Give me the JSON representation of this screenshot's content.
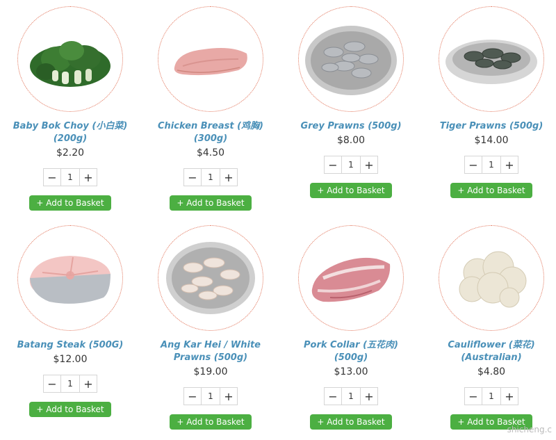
{
  "products": [
    {
      "name": "Baby Bok Choy (小白菜) (200g)",
      "price": "$2.20",
      "qty": "1",
      "add_label": "+ Add to Basket",
      "image": "bok-choy"
    },
    {
      "name": "Chicken Breast (鸡胸) (300g)",
      "price": "$4.50",
      "qty": "1",
      "add_label": "+ Add to Basket",
      "image": "chicken-breast"
    },
    {
      "name": "Grey Prawns (500g)",
      "price": "$8.00",
      "qty": "1",
      "add_label": "+ Add to Basket",
      "image": "grey-prawns"
    },
    {
      "name": "Tiger Prawns (500g)",
      "price": "$14.00",
      "qty": "1",
      "add_label": "+ Add to Basket",
      "image": "tiger-prawns"
    },
    {
      "name": "Batang Steak (500G)",
      "price": "$12.00",
      "qty": "1",
      "add_label": "+ Add to Basket",
      "image": "batang-steak"
    },
    {
      "name": "Ang Kar Hei / White Prawns (500g)",
      "price": "$19.00",
      "qty": "1",
      "add_label": "+ Add to Basket",
      "image": "white-prawns"
    },
    {
      "name": "Pork Collar (五花肉) (500g)",
      "price": "$13.00",
      "qty": "1",
      "add_label": "+ Add to Basket",
      "image": "pork-collar"
    },
    {
      "name": "Cauliflower (菜花) (Australian)",
      "price": "$4.80",
      "qty": "1",
      "add_label": "+ Add to Basket",
      "image": "cauliflower"
    }
  ],
  "qty_minus": "−",
  "qty_plus": "+",
  "watermark": "shicheng.c"
}
